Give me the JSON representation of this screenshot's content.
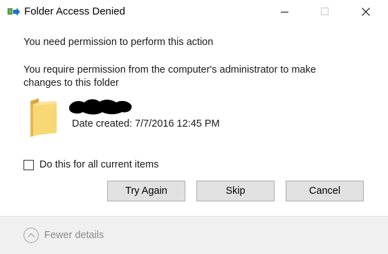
{
  "window": {
    "title": "Folder Access Denied",
    "icon": "file-move-icon",
    "controls": {
      "minimize": "minimize-icon",
      "maximize": "maximize-icon",
      "close": "close-icon"
    }
  },
  "content": {
    "heading": "You need permission to perform this action",
    "message": "You require permission from the computer's administrator to make changes to this folder",
    "item": {
      "icon": "folder-icon",
      "name_redacted": true,
      "date_created": "Date created: 7/7/2016 12:45 PM"
    },
    "checkbox": {
      "label": "Do this for all current items",
      "checked": false
    }
  },
  "buttons": {
    "try_again": "Try Again",
    "skip": "Skip",
    "cancel": "Cancel"
  },
  "footer": {
    "details_label": "Fewer details",
    "details_icon": "chevron-up-icon"
  },
  "colors": {
    "folder": "#f8d775",
    "button_bg": "#e1e1e1",
    "footer_bg": "#f0f0f0"
  }
}
